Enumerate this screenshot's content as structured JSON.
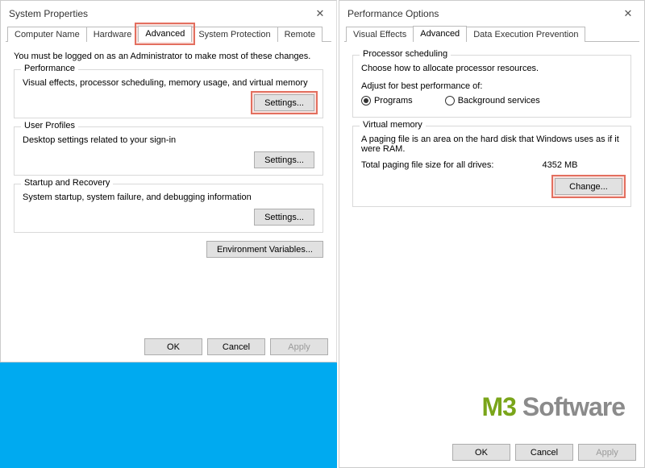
{
  "left": {
    "title": "System Properties",
    "tabs": [
      "Computer Name",
      "Hardware",
      "Advanced",
      "System Protection",
      "Remote"
    ],
    "active_tab_index": 2,
    "intro": "You must be logged on as an Administrator to make most of these changes.",
    "performance": {
      "label": "Performance",
      "desc": "Visual effects, processor scheduling, memory usage, and virtual memory",
      "button": "Settings..."
    },
    "userprofiles": {
      "label": "User Profiles",
      "desc": "Desktop settings related to your sign-in",
      "button": "Settings..."
    },
    "startup": {
      "label": "Startup and Recovery",
      "desc": "System startup, system failure, and debugging information",
      "button": "Settings..."
    },
    "envvars_button": "Environment Variables...",
    "footer": {
      "ok": "OK",
      "cancel": "Cancel",
      "apply": "Apply"
    }
  },
  "right": {
    "title": "Performance Options",
    "tabs": [
      "Visual Effects",
      "Advanced",
      "Data Execution Prevention"
    ],
    "active_tab_index": 1,
    "processor": {
      "label": "Processor scheduling",
      "desc": "Choose how to allocate processor resources.",
      "adjust_label": "Adjust for best performance of:",
      "option_programs": "Programs",
      "option_bg": "Background services",
      "selected": "programs"
    },
    "vm": {
      "label": "Virtual memory",
      "desc": "A paging file is an area on the hard disk that Windows uses as if it were RAM.",
      "total_label": "Total paging file size for all drives:",
      "total_value": "4352 MB",
      "button": "Change..."
    },
    "footer": {
      "ok": "OK",
      "cancel": "Cancel",
      "apply": "Apply"
    }
  },
  "watermark": {
    "m": "M",
    "three": "3",
    "rest": " Software"
  }
}
